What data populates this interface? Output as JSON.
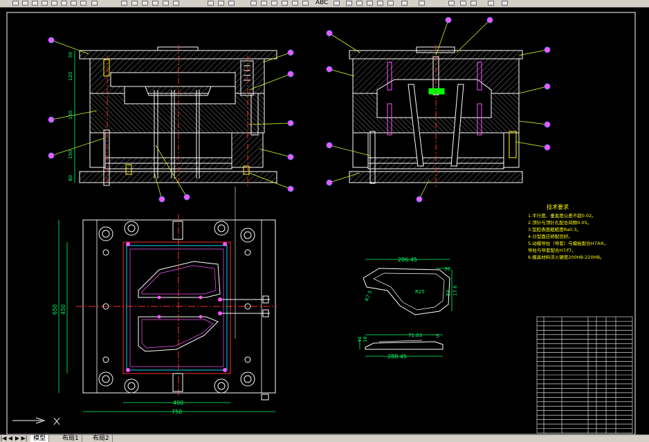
{
  "tabs": {
    "model": "模型",
    "layout1": "布局1",
    "layout2": "布局2"
  },
  "toolbar": {
    "abc_label": "ABC"
  },
  "drawing": {
    "dims_front": [
      "30",
      "120",
      "150",
      "150",
      "80"
    ],
    "dims_plan": {
      "width_inner": "400",
      "width_outer": "750",
      "height_outer": "650",
      "height_inner": "450"
    },
    "part_dims": {
      "length_top": "286.45",
      "w30": "30",
      "r7_5": "R7.5",
      "r25": "R25",
      "h83": "83",
      "h17_6": "17.6",
      "h41": "41",
      "h16": "16",
      "len71": "71.03",
      "len_bottom": "288.45",
      "r5": "5"
    },
    "tech_req": {
      "title": "技术要求",
      "items": [
        "1.平行度、垂直度公差不超0.02。",
        "2.顶针与顶针孔配合间隙0.05。",
        "3.型腔表面粗糙度Ra0.3。",
        "4.分型面应研配良好。",
        "5.动模导柱（导套）与模板配合H7/k6，",
        "   导柱与导套配合H7/f7。",
        "6.模具材料淬火硬度200HB-220HB。"
      ]
    }
  },
  "colors": {
    "background": "#000000",
    "outline": "#ffffff",
    "hatch": "#bdbdbd",
    "center": "#ff3030",
    "leader": "#c8ff20",
    "balloon": "#5577ff",
    "balloon_fill": "#ff55ff",
    "dimension": "#00ff66",
    "text": "#ffff00",
    "cyan": "#00d7ff",
    "green_part": "#00ff00"
  }
}
